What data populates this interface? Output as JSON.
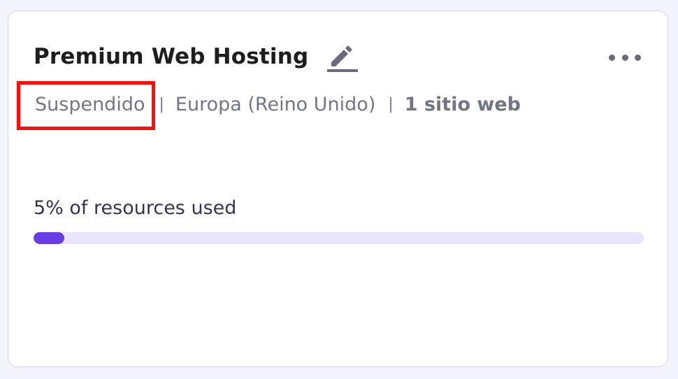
{
  "card": {
    "title": "Premium Web Hosting",
    "edit_icon": "pencil-icon",
    "more_icon": "more-horizontal-icon",
    "status": "Suspendido",
    "separator": "|",
    "region": "Europa (Reino Unido)",
    "websites": "1 sitio web",
    "usage_label": "5% of resources used",
    "usage_fraction": 0.05
  },
  "colors": {
    "title": "#1d1e20",
    "meta_text": "#727586",
    "progress_track": "#ebe4ff",
    "progress_fill": "#673de6",
    "highlight": "#ff0d0d"
  }
}
